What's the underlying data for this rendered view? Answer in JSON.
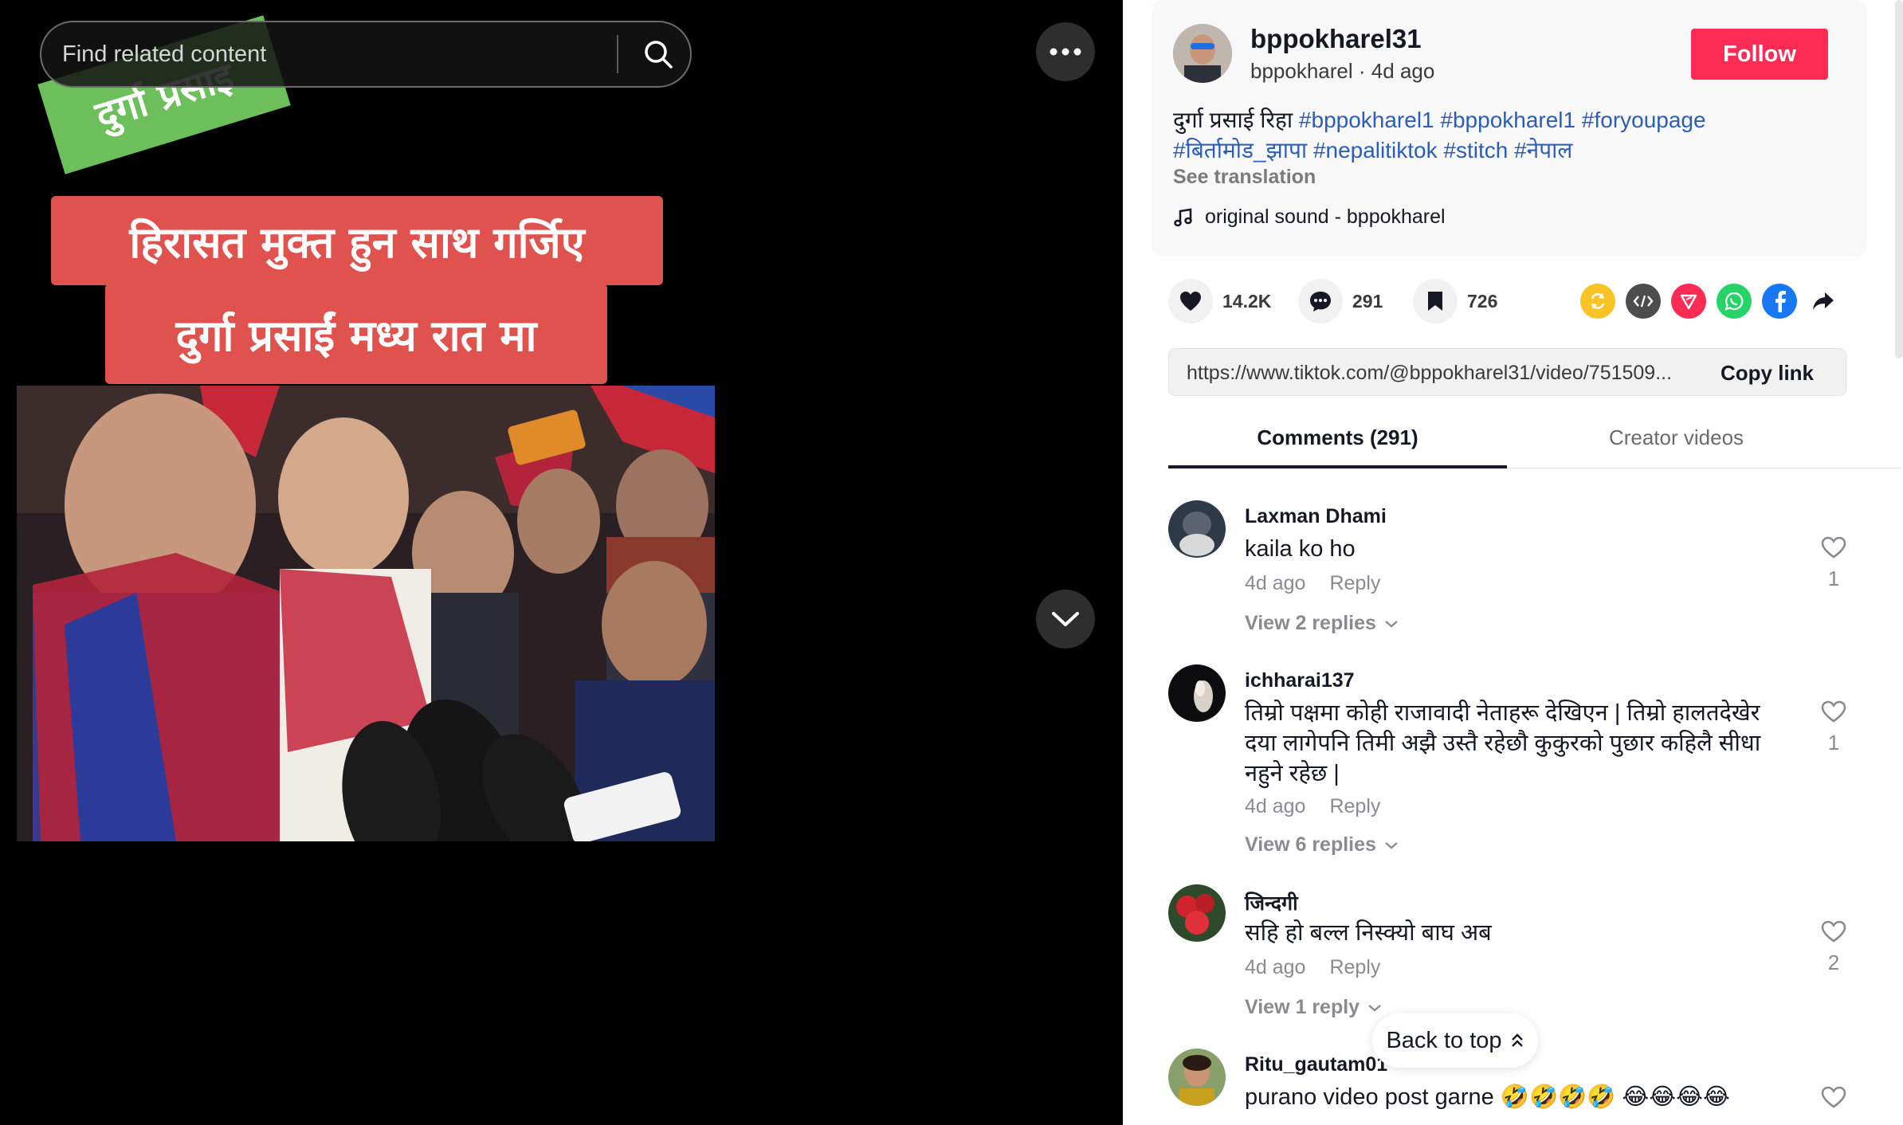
{
  "search": {
    "placeholder": "Find related content",
    "icon": "search-icon"
  },
  "video": {
    "tag_text": "दुर्गा प्रसाइ",
    "banner_line1": "हिरासत मुक्त हुन साथ गर्जिए",
    "banner_line2": "दुर्गा प्रसाईं  मध्य रात मा",
    "more_icon": "more-horizontal-icon",
    "scroll_icon": "chevron-down-icon"
  },
  "author": {
    "handle": "bppokharel31",
    "name": "bppokharel",
    "age": "4d ago",
    "separator": "·",
    "follow_label": "Follow"
  },
  "post": {
    "caption_text": "दुर्गा प्रसाई रिहा",
    "hashtags": [
      "#bppokharel1",
      "#bppokharel1",
      "#foryoupage",
      "#बिर्तामोड_झापा",
      "#nepalitiktok",
      "#stitch",
      "#नेपाल"
    ],
    "see_translation": "See translation",
    "sound": "original sound - bppokharel"
  },
  "actions": {
    "likes": "14.2K",
    "comments": "291",
    "saves": "726"
  },
  "share": [
    "repost-icon",
    "embed-icon",
    "send-icon",
    "whatsapp-icon",
    "facebook-icon",
    "share-arrow-icon"
  ],
  "link": {
    "url": "https://www.tiktok.com/@bppokharel31/video/751509...",
    "copy_label": "Copy link"
  },
  "tabs": {
    "comments": "Comments (291)",
    "creator": "Creator videos"
  },
  "comments": [
    {
      "user": "Laxman Dhami",
      "text": "kaila ko ho",
      "age": "4d ago",
      "reply": "Reply",
      "replies": "View 2 replies",
      "likes": "1"
    },
    {
      "user": "ichharai137",
      "text": "तिम्रो पक्षमा कोही राजावादी नेताहरू देखिएन | तिम्रो हालतदेखेर दया लागेपनि तिमी अझै उस्तै रहेछौ कुकुरको पुछार कहिलै सीधा नहुने रहेछ |",
      "age": "4d ago",
      "reply": "Reply",
      "replies": "View 6 replies",
      "likes": "1"
    },
    {
      "user": "जिन्दगी",
      "text": "सहि हो बल्ल निस्क्यो बाघ अब",
      "age": "4d ago",
      "reply": "Reply",
      "replies": "View 1 reply",
      "likes": "2"
    },
    {
      "user": "Ritu_gautam01",
      "text": "purano video post garne 🤣🤣🤣🤣 😂😂😂😂",
      "age": "",
      "reply": "",
      "replies": "",
      "likes": ""
    }
  ],
  "back_to_top": "Back to top",
  "colors": {
    "follow": "#fe2c55",
    "hashtag": "#2b5db9",
    "banner": "#e0524e",
    "tag": "#6cbf5a"
  }
}
